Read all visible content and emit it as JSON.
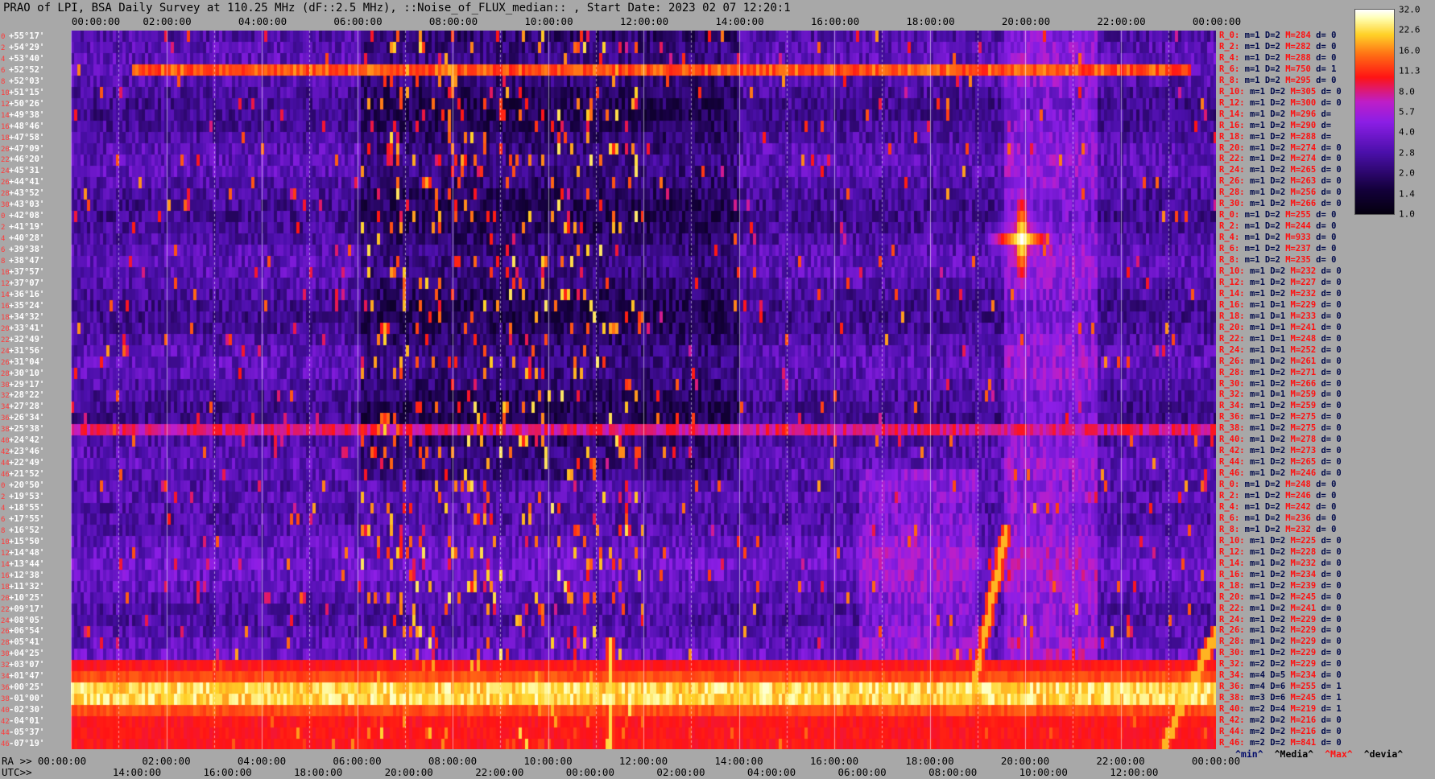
{
  "title": "PRAO of LPI, BSA Daily Survey at 110.25 MHz (dF::2.5 MHz), ::Noise_of_FLUX_median:: , Start Date: 2023 02 07 12:20:1",
  "colors": {
    "background": "#a8a8a8",
    "low": "#050010",
    "mid": "#8a1ae0",
    "high": "#ff1010",
    "peak": "#ffffff"
  },
  "chart_data": {
    "type": "heatmap",
    "title": "PRAO of LPI, BSA Daily Survey at 110.25 MHz (dF::2.5 MHz), ::Noise_of_FLUX_median:: , Start Date: 2023 02 07 12:20:1",
    "x_top_ticks": [
      "00:00:00",
      "02:00:00",
      "04:00:00",
      "06:00:00",
      "08:00:00",
      "10:00:00",
      "12:00:00",
      "14:00:00",
      "16:00:00",
      "18:00:00",
      "20:00:00",
      "22:00:00",
      "00:00:00"
    ],
    "x_bottom_ra_prefix": "RA >>",
    "x_bottom_ra_ticks": [
      "00:00:00",
      "02:00:00",
      "04:00:00",
      "06:00:00",
      "08:00:00",
      "10:00:00",
      "12:00:00",
      "14:00:00",
      "16:00:00",
      "18:00:00",
      "20:00:00",
      "22:00:00",
      "00:00:00"
    ],
    "x_bottom_utc_prefix": "UTC>>",
    "x_bottom_utc_ticks": [
      "14:00:00",
      "16:00:00",
      "18:00:00",
      "20:00:00",
      "22:00:00",
      "00:00:00",
      "02:00:00",
      "04:00:00",
      "06:00:00",
      "08:00:00",
      "10:00:00",
      "12:00:00"
    ],
    "colorbar": {
      "ticks": [
        "32.0",
        "22.6",
        "16.0",
        "11.3",
        "8.0",
        "5.7",
        "4.0",
        "2.8",
        "2.0",
        "1.4",
        "1.0"
      ],
      "scale": "log"
    },
    "declinations": [
      "+55°17'",
      "+54°29'",
      "+53°40'",
      "+52°52'",
      "+52°03'",
      "+51°15'",
      "+50°26'",
      "+49°38'",
      "+48°46'",
      "+47°58'",
      "+47°09'",
      "+46°20'",
      "+45°31'",
      "+44°41'",
      "+43°52'",
      "+43°03'",
      "+42°08'",
      "+41°19'",
      "+40°28'",
      "+39°38'",
      "+38°47'",
      "+37°57'",
      "+37°07'",
      "+36°16'",
      "+35°24'",
      "+34°32'",
      "+33°41'",
      "+32°49'",
      "+31°56'",
      "+31°04'",
      "+30°10'",
      "+29°17'",
      "+28°22'",
      "+27°28'",
      "+26°34'",
      "+25°38'",
      "+24°42'",
      "+23°46'",
      "+22°49'",
      "+21°52'",
      "+20°50'",
      "+19°53'",
      "+18°55'",
      "+17°55'",
      "+16°52'",
      "+15°50'",
      "+14°48'",
      "+13°44'",
      "+12°38'",
      "+11°32'",
      "+10°25'",
      "+09°17'",
      "+08°05'",
      "+06°54'",
      "+05°41'",
      "+04°25'",
      "+03°07'",
      "+01°47'",
      "+00°25'",
      "-01°00'",
      "-02°30'",
      "-04°01'",
      "-05°37'",
      "-07°19'"
    ],
    "dec_index": [
      "0",
      "2",
      "4",
      "6",
      "8",
      "10",
      "12",
      "14",
      "16",
      "18",
      "20",
      "22",
      "24",
      "26",
      "28",
      "30",
      "0",
      "2",
      "4",
      "6",
      "8",
      "10",
      "12",
      "14",
      "16",
      "18",
      "20",
      "22",
      "24",
      "26",
      "28",
      "30",
      "32",
      "34",
      "36",
      "38",
      "40",
      "42",
      "44",
      "46",
      "0",
      "2",
      "4",
      "6",
      "8",
      "10",
      "12",
      "14",
      "16",
      "18",
      "20",
      "22",
      "24",
      "26",
      "28",
      "30",
      "32",
      "34",
      "36",
      "38",
      "40",
      "42",
      "44",
      "46"
    ],
    "row_stats": [
      [
        "R_0:",
        "m=1",
        "D=2",
        "M=284",
        "d= 0"
      ],
      [
        "R_2:",
        "m=1",
        "D=2",
        "M=282",
        "d= 0"
      ],
      [
        "R_4:",
        "m=1",
        "D=2",
        "M=288",
        "d= 0"
      ],
      [
        "R_6:",
        "m=1",
        "D=2",
        "M=750",
        "d= 1"
      ],
      [
        "R_8:",
        "m=1",
        "D=2",
        "M=295",
        "d= 0"
      ],
      [
        "R_10:",
        "m=1",
        "D=2",
        "M=305",
        "d= 0"
      ],
      [
        "R_12:",
        "m=1",
        "D=2",
        "M=300",
        "d= 0"
      ],
      [
        "R_14:",
        "m=1",
        "D=2",
        "M=296",
        "d="
      ],
      [
        "R_16:",
        "m=1",
        "D=2",
        "M=290",
        "d="
      ],
      [
        "R_18:",
        "m=1",
        "D=2",
        "M=288",
        "d="
      ],
      [
        "R_20:",
        "m=1",
        "D=2",
        "M=274",
        "d= 0"
      ],
      [
        "R_22:",
        "m=1",
        "D=2",
        "M=274",
        "d= 0"
      ],
      [
        "R_24:",
        "m=1",
        "D=2",
        "M=265",
        "d= 0"
      ],
      [
        "R_26:",
        "m=1",
        "D=2",
        "M=263",
        "d= 0"
      ],
      [
        "R_28:",
        "m=1",
        "D=2",
        "M=256",
        "d= 0"
      ],
      [
        "R_30:",
        "m=1",
        "D=2",
        "M=266",
        "d= 0"
      ],
      [
        "R_0:",
        "m=1",
        "D=2",
        "M=255",
        "d= 0"
      ],
      [
        "R_2:",
        "m=1",
        "D=2",
        "M=244",
        "d= 0"
      ],
      [
        "R_4:",
        "m=1",
        "D=2",
        "M=933",
        "d= 0"
      ],
      [
        "R_6:",
        "m=1",
        "D=2",
        "M=237",
        "d= 0"
      ],
      [
        "R_8:",
        "m=1",
        "D=2",
        "M=235",
        "d= 0"
      ],
      [
        "R_10:",
        "m=1",
        "D=2",
        "M=232",
        "d= 0"
      ],
      [
        "R_12:",
        "m=1",
        "D=2",
        "M=227",
        "d= 0"
      ],
      [
        "R_14:",
        "m=1",
        "D=2",
        "M=232",
        "d= 0"
      ],
      [
        "R_16:",
        "m=1",
        "D=1",
        "M=229",
        "d= 0"
      ],
      [
        "R_18:",
        "m=1",
        "D=1",
        "M=233",
        "d= 0"
      ],
      [
        "R_20:",
        "m=1",
        "D=1",
        "M=241",
        "d= 0"
      ],
      [
        "R_22:",
        "m=1",
        "D=1",
        "M=248",
        "d= 0"
      ],
      [
        "R_24:",
        "m=1",
        "D=1",
        "M=252",
        "d= 0"
      ],
      [
        "R_26:",
        "m=1",
        "D=2",
        "M=261",
        "d= 0"
      ],
      [
        "R_28:",
        "m=1",
        "D=2",
        "M=271",
        "d= 0"
      ],
      [
        "R_30:",
        "m=1",
        "D=2",
        "M=266",
        "d= 0"
      ],
      [
        "R_32:",
        "m=1",
        "D=1",
        "M=259",
        "d= 0"
      ],
      [
        "R_34:",
        "m=1",
        "D=2",
        "M=259",
        "d= 0"
      ],
      [
        "R_36:",
        "m=1",
        "D=2",
        "M=275",
        "d= 0"
      ],
      [
        "R_38:",
        "m=1",
        "D=2",
        "M=275",
        "d= 0"
      ],
      [
        "R_40:",
        "m=1",
        "D=2",
        "M=278",
        "d= 0"
      ],
      [
        "R_42:",
        "m=1",
        "D=2",
        "M=273",
        "d= 0"
      ],
      [
        "R_44:",
        "m=1",
        "D=2",
        "M=265",
        "d= 0"
      ],
      [
        "R_46:",
        "m=1",
        "D=2",
        "M=246",
        "d= 0"
      ],
      [
        "R_0:",
        "m=1",
        "D=2",
        "M=248",
        "d= 0"
      ],
      [
        "R_2:",
        "m=1",
        "D=2",
        "M=246",
        "d= 0"
      ],
      [
        "R_4:",
        "m=1",
        "D=2",
        "M=242",
        "d= 0"
      ],
      [
        "R_6:",
        "m=1",
        "D=2",
        "M=236",
        "d= 0"
      ],
      [
        "R_8:",
        "m=1",
        "D=2",
        "M=232",
        "d= 0"
      ],
      [
        "R_10:",
        "m=1",
        "D=2",
        "M=225",
        "d= 0"
      ],
      [
        "R_12:",
        "m=1",
        "D=2",
        "M=228",
        "d= 0"
      ],
      [
        "R_14:",
        "m=1",
        "D=2",
        "M=232",
        "d= 0"
      ],
      [
        "R_16:",
        "m=1",
        "D=2",
        "M=234",
        "d= 0"
      ],
      [
        "R_18:",
        "m=1",
        "D=2",
        "M=239",
        "d= 0"
      ],
      [
        "R_20:",
        "m=1",
        "D=2",
        "M=245",
        "d= 0"
      ],
      [
        "R_22:",
        "m=1",
        "D=2",
        "M=241",
        "d= 0"
      ],
      [
        "R_24:",
        "m=1",
        "D=2",
        "M=229",
        "d= 0"
      ],
      [
        "R_26:",
        "m=1",
        "D=2",
        "M=229",
        "d= 0"
      ],
      [
        "R_28:",
        "m=1",
        "D=2",
        "M=229",
        "d= 0"
      ],
      [
        "R_30:",
        "m=1",
        "D=2",
        "M=229",
        "d= 0"
      ],
      [
        "R_32:",
        "m=2",
        "D=2",
        "M=229",
        "d= 0"
      ],
      [
        "R_34:",
        "m=4",
        "D=5",
        "M=234",
        "d= 0"
      ],
      [
        "R_36:",
        "m=4",
        "D=6",
        "M=255",
        "d= 1"
      ],
      [
        "R_38:",
        "m=3",
        "D=6",
        "M=245",
        "d= 1"
      ],
      [
        "R_40:",
        "m=2",
        "D=4",
        "M=219",
        "d= 1"
      ],
      [
        "R_42:",
        "m=2",
        "D=2",
        "M=216",
        "d= 0"
      ],
      [
        "R_44:",
        "m=2",
        "D=2",
        "M=216",
        "d= 0"
      ],
      [
        "R_46:",
        "m=2",
        "D=2",
        "M=841",
        "d= 0"
      ]
    ],
    "legend": [
      "^min^",
      "^Media^",
      "^Max^",
      "^devia^"
    ],
    "features": [
      {
        "kind": "horizontal_band",
        "dec_row": 3,
        "ra_start": 1.3,
        "ra_end": 23.5,
        "level": "high"
      },
      {
        "kind": "horizontal_band",
        "dec_row": 35,
        "ra_start": 0.0,
        "ra_end": 24.0,
        "level": "mid-high"
      },
      {
        "kind": "horizontal_band",
        "dec_row": 58,
        "ra_start": 0.0,
        "ra_end": 24.0,
        "level": "peak"
      },
      {
        "kind": "horizontal_band",
        "dec_row": 59,
        "ra_start": 0.0,
        "ra_end": 24.0,
        "level": "peak"
      },
      {
        "kind": "point_source",
        "dec_row": 18,
        "ra": 19.95,
        "level": "peak"
      },
      {
        "kind": "diagonal_track",
        "ra_start": 18.9,
        "dec_start": 58,
        "ra_end": 19.6,
        "dec_end": 44
      },
      {
        "kind": "diagonal_track",
        "ra_start": 22.9,
        "dec_start": 63,
        "ra_end": 24.0,
        "dec_end": 53
      },
      {
        "kind": "vertical_bright",
        "ra": 11.3,
        "dec_start": 54,
        "dec_end": 63
      }
    ]
  }
}
